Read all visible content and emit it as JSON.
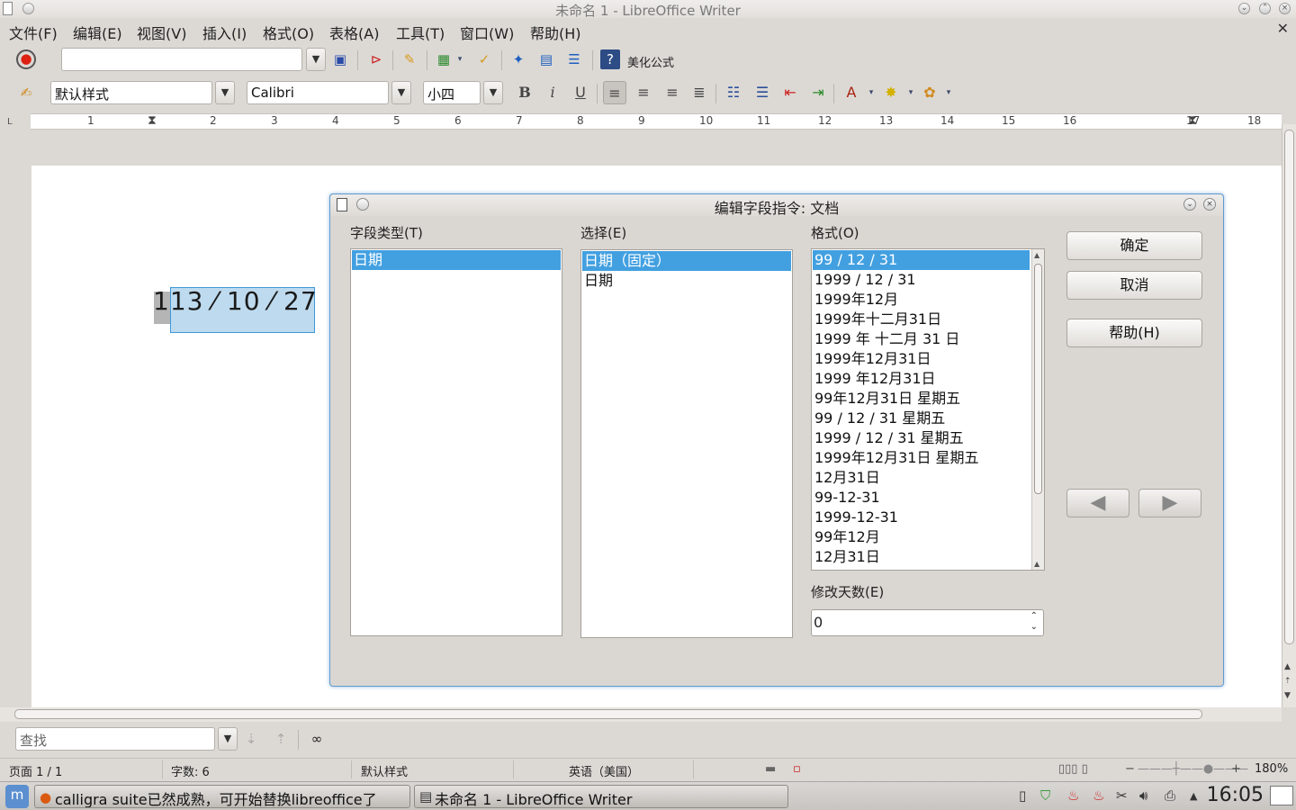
{
  "window": {
    "title": "未命名 1 - LibreOffice Writer"
  },
  "menu": [
    "文件(F)",
    "编辑(E)",
    "视图(V)",
    "插入(I)",
    "格式(O)",
    "表格(A)",
    "工具(T)",
    "窗口(W)",
    "帮助(H)"
  ],
  "toolbar1": {
    "url_value": "",
    "beautify_label": "美化公式"
  },
  "toolbar2": {
    "style": "默认样式",
    "font": "Calibri",
    "size": "小四"
  },
  "ruler": [
    "1",
    "2",
    "3",
    "4",
    "5",
    "6",
    "7",
    "8",
    "9",
    "10",
    "11",
    "12",
    "13",
    "14",
    "15",
    "16",
    "17",
    "18"
  ],
  "document": {
    "field_text": "113 ⁄ 10 ⁄ 27"
  },
  "dialog": {
    "title": "编辑字段指令: 文档",
    "field_type_label": "字段类型(T)",
    "field_types": [
      "日期"
    ],
    "select_label": "选择(E)",
    "selections": [
      "日期（固定）",
      "日期"
    ],
    "format_label": "格式(O)",
    "formats": [
      "99 / 12 / 31",
      "1999 / 12 / 31",
      "1999年12月",
      "1999年十二月31日",
      "1999 年 十二月 31 日",
      "1999年12月31日",
      "1999 年12月31日",
      "99年12月31日 星期五",
      "99 / 12 / 31 星期五",
      "1999 / 12 / 31 星期五",
      "1999年12月31日 星期五",
      "12月31日",
      "99-12-31",
      "1999-12-31",
      "99年12月",
      "12月31日"
    ],
    "offset_label": "修改天数(E)",
    "offset_value": "0",
    "ok": "确定",
    "cancel": "取消",
    "help": "帮助(H)"
  },
  "findbar": {
    "placeholder": "查找"
  },
  "status": {
    "page": "页面 1 / 1",
    "words": "字数: 6",
    "style": "默认样式",
    "language": "英语（美国）",
    "zoom": "180%"
  },
  "taskbar": {
    "task1": "calligra suite已然成熟，可开始替换libreoffice了",
    "task2": "未命名 1 - LibreOffice Writer",
    "clock": "16:05"
  }
}
